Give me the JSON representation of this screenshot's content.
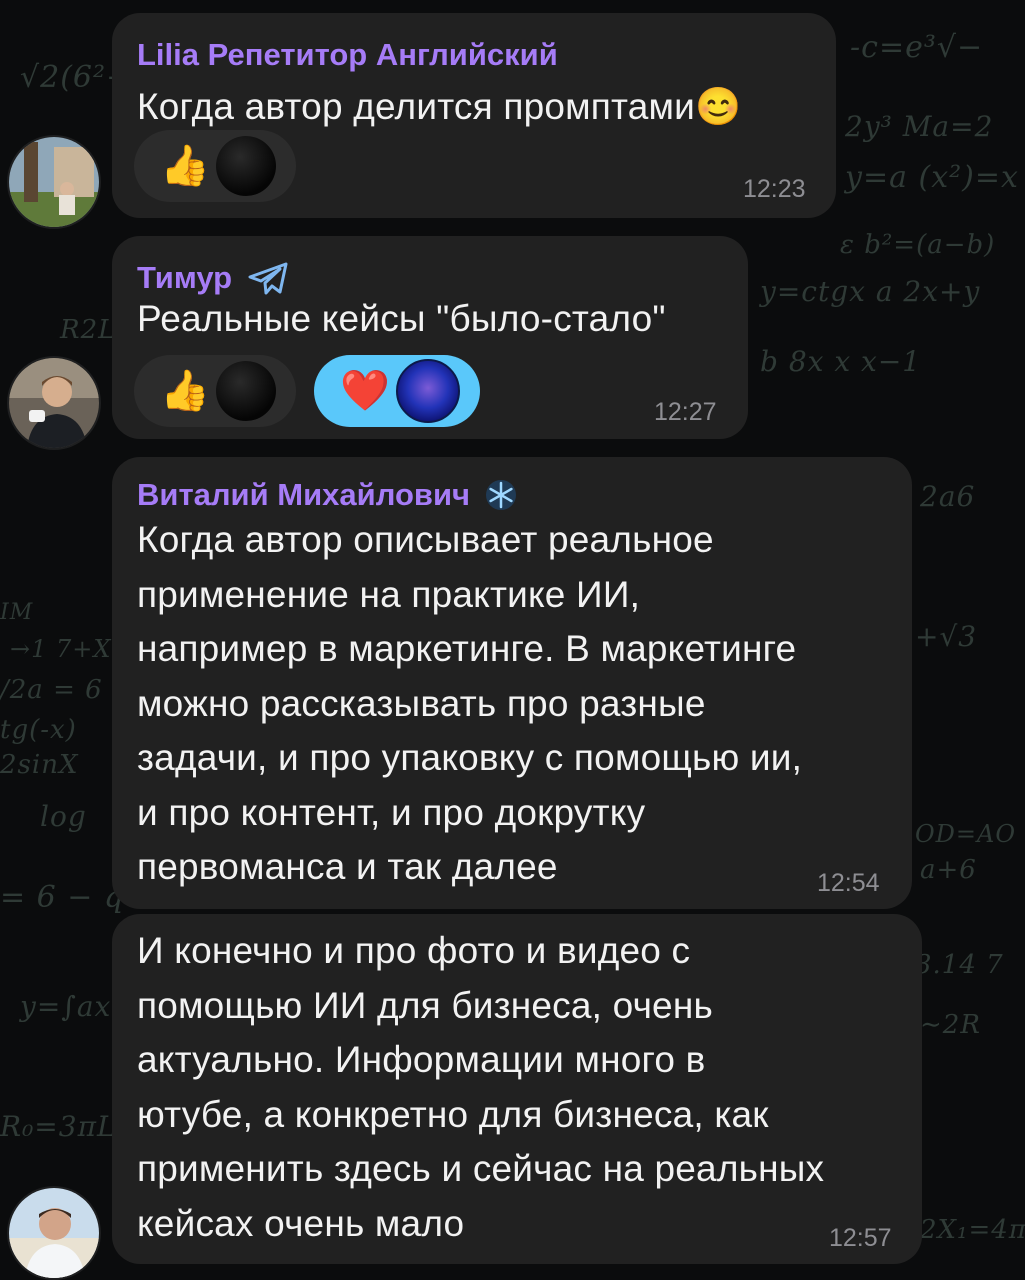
{
  "colors": {
    "background": "#0b0c0d",
    "bubble": "#212121",
    "sender_name": "#a67cf7",
    "timestamp": "#8e8e93",
    "reaction_active": "#5ac8fa"
  },
  "messages": [
    {
      "sender": "Lilia Репетитор Английский",
      "text": "Когда автор делится промптами😊",
      "time": "12:23",
      "reactions": [
        {
          "emoji": "👍",
          "active": false
        }
      ]
    },
    {
      "sender": "Тимур",
      "sender_badge_icon": "telegram-plane-icon",
      "text": "Реальные кейсы \"было-стало\"",
      "time": "12:27",
      "reactions": [
        {
          "emoji": "👍",
          "active": false
        },
        {
          "emoji": "❤️",
          "active": true
        }
      ]
    },
    {
      "sender": "Виталий Михайлович",
      "sender_badge_icon": "snowflake-icon",
      "text_lines": [
        "Когда автор описывает реальное",
        "применение на практике ИИ,",
        "например в маркетинге. В маркетинге",
        "можно рассказывать про разные",
        "задачи, и про упаковку с помощью ии,",
        "и про контент, и про докрутку",
        "первоманса и так далее"
      ],
      "time": "12:54"
    },
    {
      "text_lines": [
        "И конечно и про фото и видео с",
        "помощью ИИ для бизнеса, очень",
        "актуально. Информации много в",
        "ютубе, а конкретно для бизнеса, как",
        "применить здесь и сейчас на реальных",
        "кейсах очень мало"
      ],
      "time": "12:57"
    }
  ]
}
